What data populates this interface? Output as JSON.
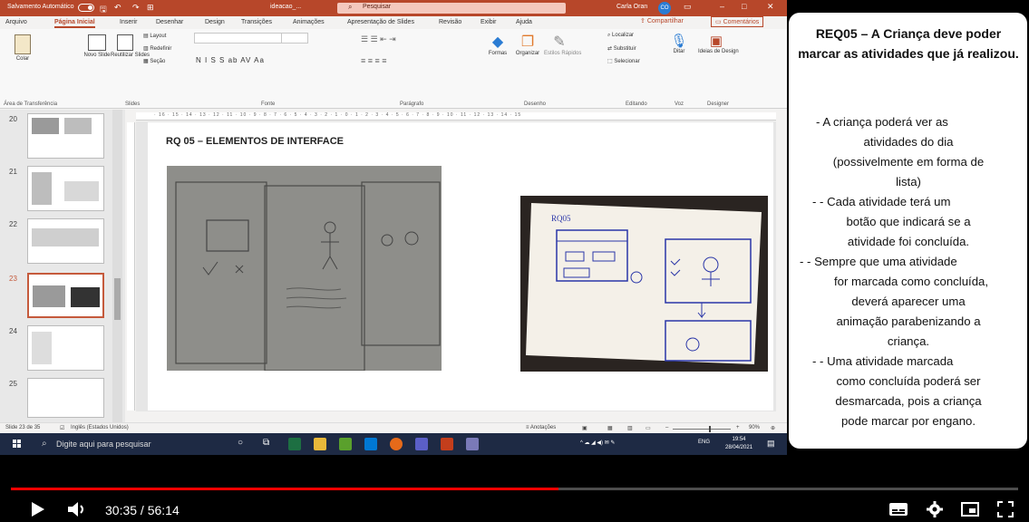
{
  "ppt": {
    "titlebar": {
      "autosave": "Salvamento Automático",
      "filename": "ideacao_...",
      "search_placeholder": "Pesquisar",
      "user": "Carla Oran",
      "user_initials": "CO"
    },
    "menu": [
      "Arquivo",
      "Página Inicial",
      "Inserir",
      "Desenhar",
      "Design",
      "Transições",
      "Animações",
      "Apresentação de Slides",
      "Revisão",
      "Exibir",
      "Ajuda"
    ],
    "active_menu": "Página Inicial",
    "share_label": "Compartilhar",
    "comments_label": "Comentários",
    "ribbon": {
      "colar": "Colar",
      "novo_slide": "Novo Slide",
      "reutilizar": "Reutilizar Slides",
      "layout": "Layout",
      "redefinir": "Redefinir",
      "secao": "Seção",
      "font_format": "N I S S ab AV Aa",
      "formas": "Formas",
      "organizar": "Organizar",
      "estilos": "Estilos Rápidos",
      "localizar": "Localizar",
      "substituir": "Substituir",
      "selecionar": "Selecionar",
      "ditar": "Ditar",
      "ideias": "Ideias de Design",
      "groups": [
        "Área de Transferência",
        "Slides",
        "Fonte",
        "Parágrafo",
        "Desenho",
        "Editando",
        "Voz",
        "Designer"
      ]
    },
    "thumbs": [
      "20",
      "21",
      "22",
      "23",
      "24",
      "25"
    ],
    "ruler": "· 16 · 15 · 14 · 13 · 12 · 11 · 10 · 9 · 8 · 7 · 6 · 5 · 4 · 3 · 2 · 1 · 0 · 1 · 2 · 3 · 4 · 5 · 6 · 7 · 8 · 9 · 10 · 11 · 12 · 13 · 14 · 15",
    "slide_title": "RQ 05 – ELEMENTOS DE INTERFACE",
    "status": {
      "slide_count": "Slide 23 de 35",
      "language": "Inglês (Estados Unidos)",
      "notes": "Anotações",
      "zoom": "90%"
    },
    "taskbar": {
      "search_placeholder": "Digite aqui para pesquisar",
      "lang": "ENG",
      "time": "19:54",
      "date": "28/04/2021"
    }
  },
  "note": {
    "heading": "REQ05 – A Criança deve poder marcar as atividades que já realizou.",
    "lines": [
      "-    A criança poderá ver as",
      "atividades do dia",
      "(possivelmente em forma de",
      "lista)",
      "-    - Cada atividade terá um",
      "botão que indicará se a",
      "atividade foi concluída.",
      "-    - Sempre que uma atividade",
      "for marcada como concluída,",
      "deverá aparecer uma",
      "animação parabenizando a",
      "criança.",
      "-    - Uma atividade marcada",
      "como concluída poderá ser",
      "desmarcada, pois a criança",
      "pode marcar por engano."
    ]
  },
  "video": {
    "time": "30:35 / 56:14",
    "progress": 0.544,
    "colors": {
      "progress": "#ff0000",
      "accent": "#b7472a"
    }
  }
}
